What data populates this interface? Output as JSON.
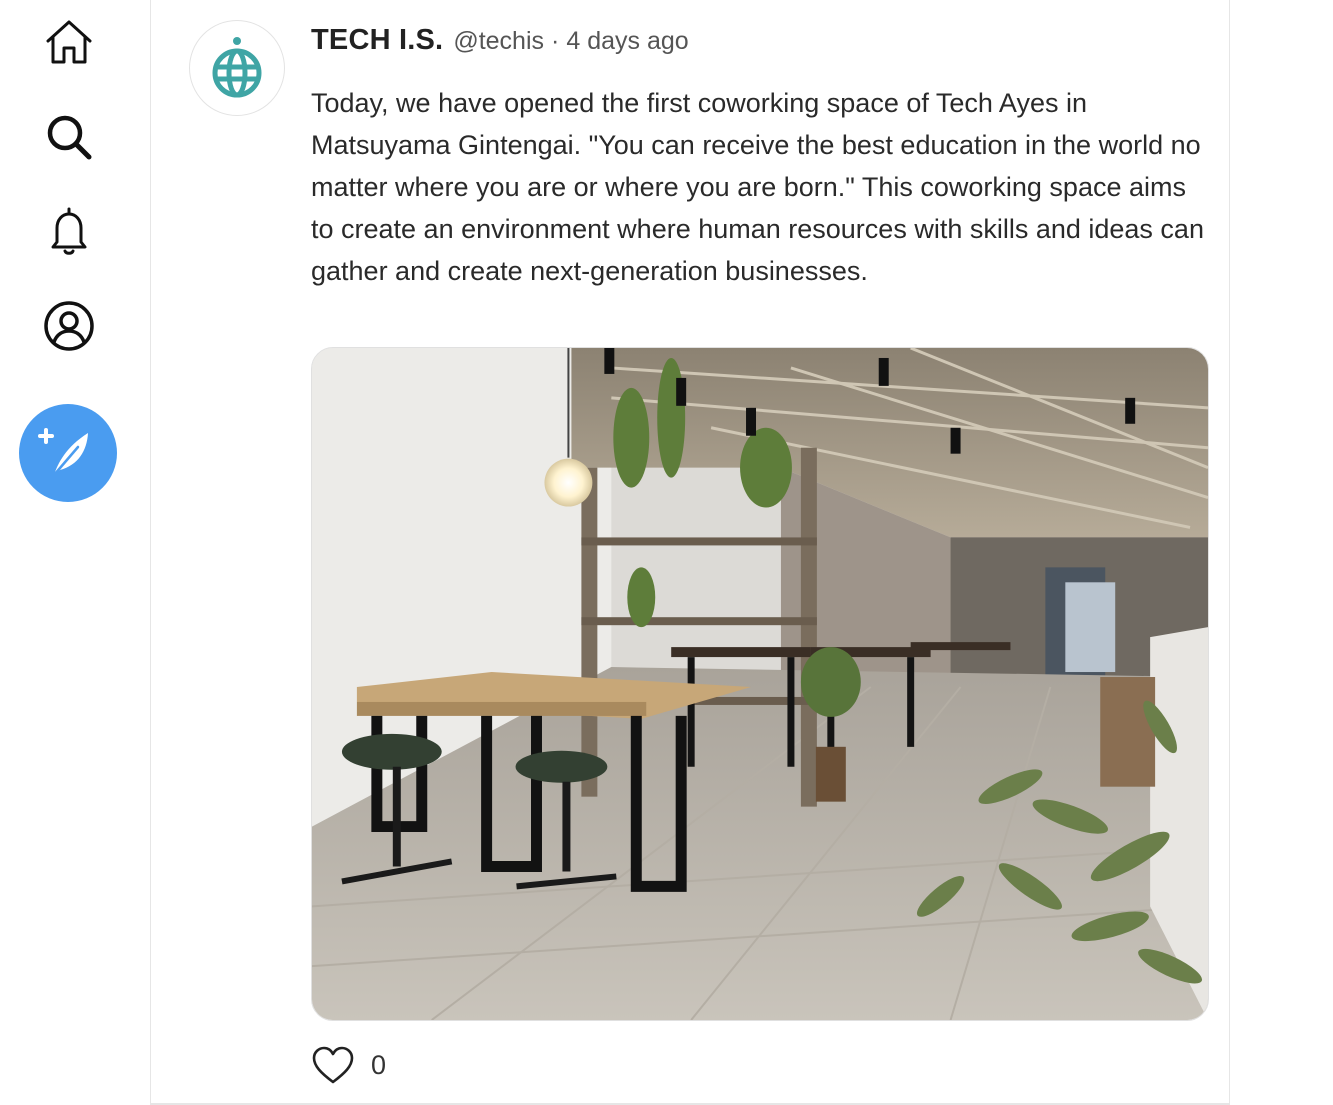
{
  "sidebar": {
    "items": [
      {
        "icon": "home-icon"
      },
      {
        "icon": "search-icon"
      },
      {
        "icon": "bell-icon"
      },
      {
        "icon": "profile-icon"
      }
    ],
    "compose": {
      "icon": "feather-plus-icon",
      "color": "#4a9cf0"
    }
  },
  "post": {
    "author_name": "TECH I.S.",
    "handle": "@techis",
    "separator": "·",
    "timestamp": "4 days ago",
    "avatar": {
      "icon": "globe-logo-icon",
      "color": "#3fa5a5"
    },
    "text": "Today, we have opened the first coworking space of Tech Ayes in Matsuyama Gintengai. \"You can receive the best education in the world no matter where you are or where you are born.\" This coworking space aims to create an environment where human resources with skills and ideas can gather and create next-generation businesses.",
    "image": {
      "icon": "photo-coworking-space"
    },
    "likes": {
      "icon": "heart-outline-icon",
      "count": "0"
    }
  }
}
